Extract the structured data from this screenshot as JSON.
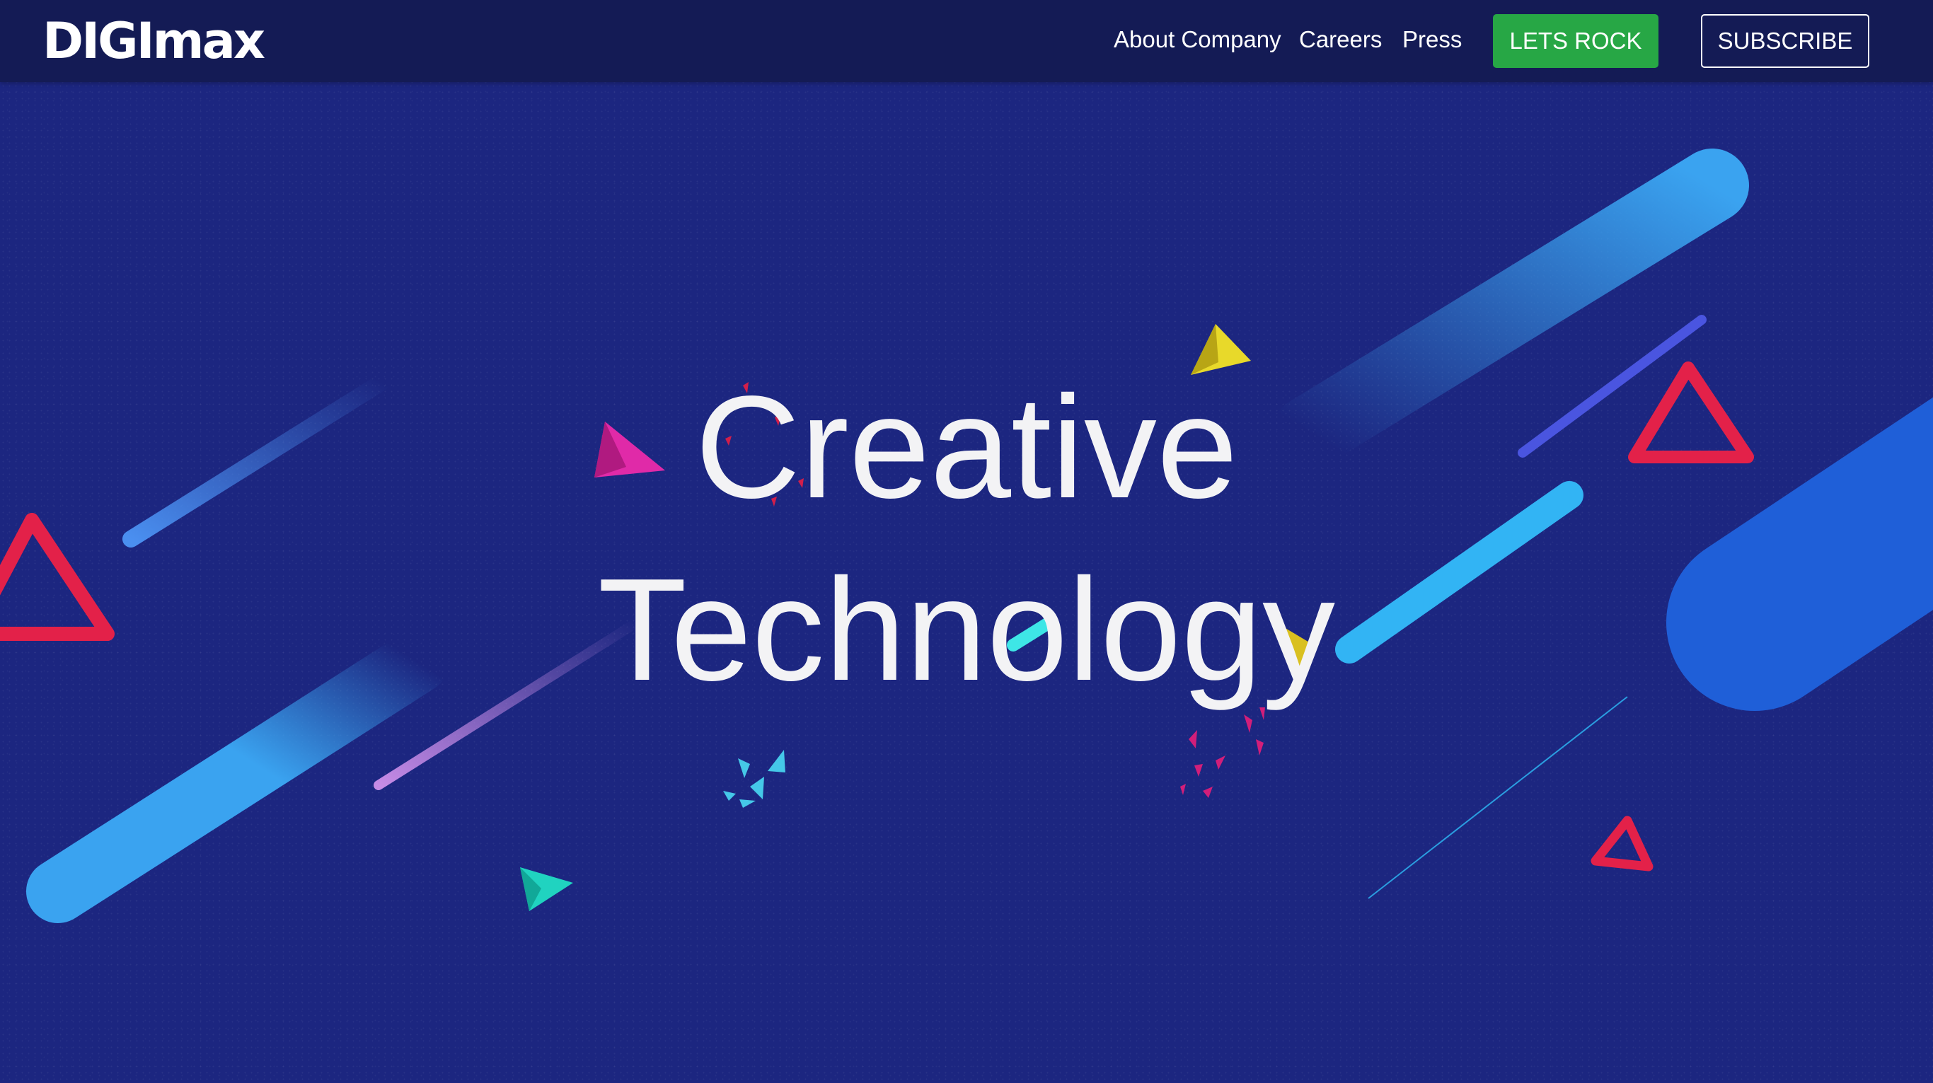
{
  "header": {
    "logo_text": "DIGImax",
    "nav_links": [
      "About Company",
      "Careers",
      "Press"
    ],
    "primary_button": "LETS ROCK",
    "secondary_button": "SUBSCRIBE"
  },
  "hero": {
    "line1": "Creative",
    "line2": "Technology"
  },
  "colors": {
    "background": "#1c2680",
    "topbar": "#141b55",
    "primary_button": "#27a745",
    "text": "#ffffff"
  }
}
